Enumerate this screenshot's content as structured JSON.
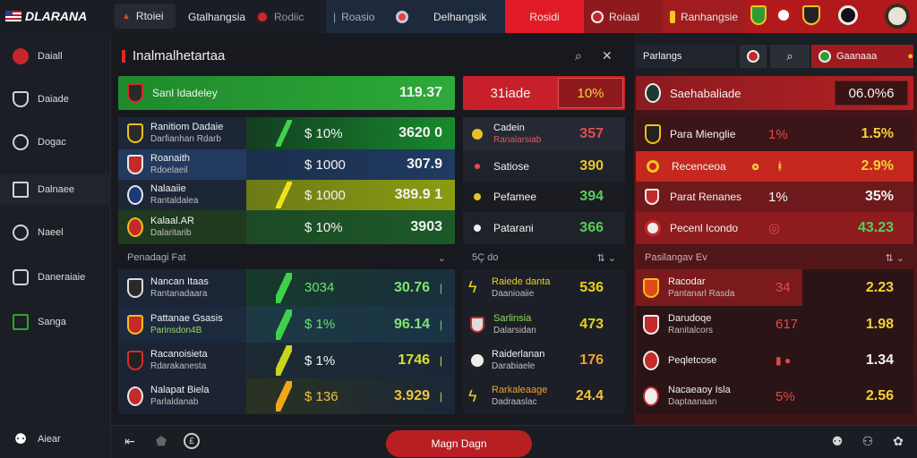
{
  "app": {
    "brand": "DLARANA"
  },
  "topbar": {
    "tabs": [
      {
        "label": "Rtoiei"
      },
      {
        "label": "Gtalhangsia"
      },
      {
        "label": "Rodiic"
      },
      {
        "label": "Roasio"
      },
      {
        "label": ""
      },
      {
        "label": "Delhangsik"
      },
      {
        "label": "Rosidi"
      },
      {
        "label": "Roiaal"
      },
      {
        "label": "Ranhangsie"
      }
    ]
  },
  "sidebar": {
    "items": [
      {
        "label": "Daiall"
      },
      {
        "label": "Daiade"
      },
      {
        "label": "Dogac"
      },
      {
        "label": "Dalnaee"
      },
      {
        "label": "Naeel"
      },
      {
        "label": "Daneraiaie"
      },
      {
        "label": "Sanga"
      },
      {
        "label": "Aiear"
      }
    ]
  },
  "page": {
    "title": "Inalmalhetartaa"
  },
  "left_panel": {
    "featured": {
      "label": "Sanl Idadeley",
      "value": "119.37"
    },
    "rows": [
      {
        "name": "Ranitiom Dadaie",
        "sub": "Darfianhan Rdarb",
        "odds": "$ 10%",
        "value": "3620  0"
      },
      {
        "name": "Roanaith",
        "sub": "Rdoelaeil",
        "odds": "$ 1000",
        "value": "307.9"
      },
      {
        "name": "Nalaaiie",
        "sub": "Rantaldalea",
        "odds": "$ 1000",
        "value": "389.9 1"
      },
      {
        "name": "Kalaal.AR",
        "sub": "Dalaritarib",
        "odds": "$ 10%",
        "value": "3903"
      }
    ],
    "group_label": "Penadagi Fat",
    "rows2": [
      {
        "name": "Nancan Itaas",
        "sub": "Rantanadaara",
        "odds": "3034",
        "value": "30.76"
      },
      {
        "name": "Pattanae Gsasis",
        "sub": "Parinsdon4B",
        "odds": "$ 1%",
        "value": "96.14"
      },
      {
        "name": "Racanoisieta",
        "sub": "Rdarakanesta",
        "odds": "$ 1%",
        "value": "1746"
      },
      {
        "name": "Nalapat Biela",
        "sub": "Parlaldanab",
        "odds": "$ 136",
        "value": "3.929"
      }
    ]
  },
  "mid_panel": {
    "header": {
      "label": "31iade",
      "value": "10%"
    },
    "rows": [
      {
        "name": "Cadein",
        "sub": "Ranalarsiab",
        "value": "357"
      },
      {
        "name": "Satiose",
        "sub": "",
        "value": "390"
      },
      {
        "name": "Pefamee",
        "sub": "",
        "value": "394"
      },
      {
        "name": "Patarani",
        "sub": "",
        "value": "366"
      }
    ],
    "group_label": "5Ç do",
    "rows2": [
      {
        "name": "Raiede danta",
        "sub": "Daanioaiie",
        "value": "536"
      },
      {
        "name": "Sarlinsia",
        "sub": "Dalarsidan",
        "value": "473"
      },
      {
        "name": "Raiderlanan",
        "sub": "Darabiaele",
        "value": "176"
      },
      {
        "name": "Rarkaleaage",
        "sub": "Dadraaslac",
        "value": "24.4"
      }
    ]
  },
  "right_panel": {
    "tabs": {
      "label1": "Parlangs",
      "label3": "Gaanaaa"
    },
    "header": {
      "label": "Saehabaliade",
      "value": "06.0%6"
    },
    "rows": [
      {
        "name": "Para Mienglie",
        "odds": "1%",
        "value": "1.5%"
      },
      {
        "name": "Recenceoa",
        "odds": "",
        "value": "2.9%"
      },
      {
        "name": "Parat Renanes",
        "odds": "1%",
        "value": "35%"
      },
      {
        "name": "Pecenl Icondo",
        "odds": "",
        "value": "43.23"
      }
    ],
    "group_label": "Pasilangav Ev",
    "rows2": [
      {
        "name": "Racodar",
        "sub": "Pantanarl Rasda",
        "odds": "34",
        "value": "2.23"
      },
      {
        "name": "Darudoqe",
        "sub": "Ranitalcors",
        "odds": "617",
        "value": "1.98"
      },
      {
        "name": "Peqletcose",
        "sub": "",
        "odds": "",
        "value": "1.34"
      },
      {
        "name": "Nacaeaoy Isla",
        "sub": "Daptaanaan",
        "odds": "5%",
        "value": "2.56"
      }
    ]
  },
  "bottom": {
    "main_button": "Magn Dagn"
  },
  "colors": {
    "accent_red": "#b81f23",
    "accent_green": "#2fa52d",
    "accent_yellow": "#e5d51a"
  }
}
